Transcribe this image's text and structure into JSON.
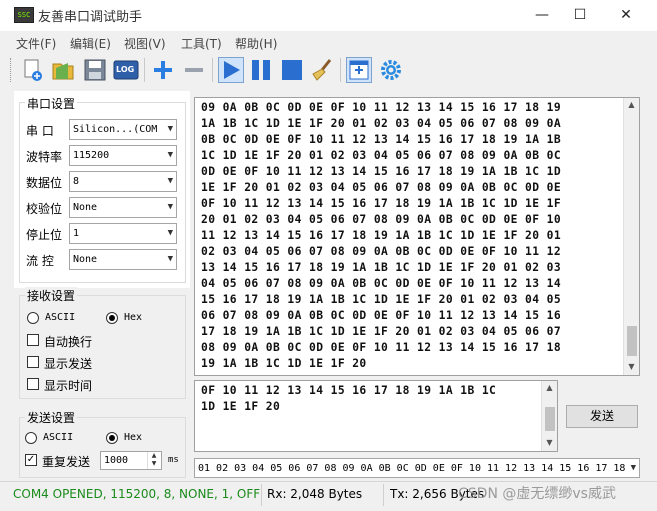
{
  "window": {
    "title": "友善串口调试助手",
    "icon_text": "SSC",
    "minimize": "—",
    "maximize": "☐",
    "close": "✕"
  },
  "menu": [
    "文件(F)",
    "编辑(E)",
    "视图(V)",
    "工具(T)",
    "帮助(H)"
  ],
  "toolbar": {
    "icons": [
      "new-icon",
      "open-folder-icon",
      "save-icon",
      "log-icon",
      "add-icon",
      "remove-icon",
      "play-icon",
      "pause-icon",
      "stop-icon",
      "broom-icon",
      "window-icon",
      "gear-icon"
    ],
    "log_text": "LOG"
  },
  "serial": {
    "title": "串口设置",
    "port_label": "串 口",
    "port_value": "Silicon...(COM",
    "baud_label": "波特率",
    "baud_value": "115200",
    "databits_label": "数据位",
    "databits_value": "8",
    "parity_label": "校验位",
    "parity_value": "None",
    "stopbits_label": "停止位",
    "stopbits_value": "1",
    "flow_label": "流 控",
    "flow_value": "None"
  },
  "receive": {
    "title": "接收设置",
    "ascii_label": "ASCII",
    "hex_label": "Hex",
    "mode": "Hex",
    "auto_wrap_label": "自动换行",
    "show_send_label": "显示发送",
    "show_time_label": "显示时间",
    "text": "09 0A 0B 0C 0D 0E 0F 10 11 12 13 14 15 16 17 18 19\n1A 1B 1C 1D 1E 1F 20 01 02 03 04 05 06 07 08 09 0A\n0B 0C 0D 0E 0F 10 11 12 13 14 15 16 17 18 19 1A 1B\n1C 1D 1E 1F 20 01 02 03 04 05 06 07 08 09 0A 0B 0C\n0D 0E 0F 10 11 12 13 14 15 16 17 18 19 1A 1B 1C 1D\n1E 1F 20 01 02 03 04 05 06 07 08 09 0A 0B 0C 0D 0E\n0F 10 11 12 13 14 15 16 17 18 19 1A 1B 1C 1D 1E 1F\n20 01 02 03 04 05 06 07 08 09 0A 0B 0C 0D 0E 0F 10\n11 12 13 14 15 16 17 18 19 1A 1B 1C 1D 1E 1F 20 01\n02 03 04 05 06 07 08 09 0A 0B 0C 0D 0E 0F 10 11 12\n13 14 15 16 17 18 19 1A 1B 1C 1D 1E 1F 20 01 02 03\n04 05 06 07 08 09 0A 0B 0C 0D 0E 0F 10 11 12 13 14\n15 16 17 18 19 1A 1B 1C 1D 1E 1F 20 01 02 03 04 05\n06 07 08 09 0A 0B 0C 0D 0E 0F 10 11 12 13 14 15 16\n17 18 19 1A 1B 1C 1D 1E 1F 20 01 02 03 04 05 06 07\n08 09 0A 0B 0C 0D 0E 0F 10 11 12 13 14 15 16 17 18\n19 1A 1B 1C 1D 1E 1F 20"
  },
  "send": {
    "title": "发送设置",
    "ascii_label": "ASCII",
    "hex_label": "Hex",
    "mode": "Hex",
    "repeat_label": "重复发送",
    "repeat_checked": true,
    "interval_value": "1000",
    "interval_unit": "ms",
    "text": "0F 10 11 12 13 14 15 16 17 18 19 1A 1B 1C\n1D 1E 1F 20",
    "button_label": "发送",
    "history_value": "01 02 03 04 05 06 07 08 09 0A 0B 0C 0D 0E 0F 10 11 12 13 14 15 16 17 18"
  },
  "status": {
    "port": "COM4 OPENED, 115200, 8, NONE, 1, OFF",
    "rx": "Rx: 2,048 Bytes",
    "tx": "Tx: 2,656 Bytes",
    "watermark": "CSDN @虚无缥缈vs威武",
    "port_color": "#1a8a1a"
  }
}
